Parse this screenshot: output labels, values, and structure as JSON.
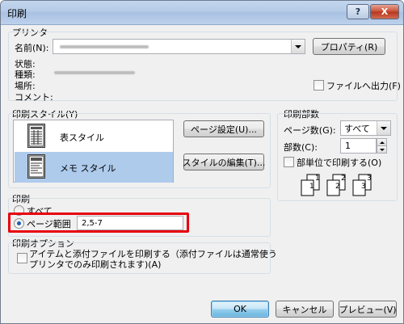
{
  "window": {
    "title": "印刷",
    "help_label": "?",
    "close_label": "X"
  },
  "printer": {
    "group_label": "プリンタ",
    "name_label": "名前(N):",
    "properties_button": "プロパティ(R)",
    "status_label": "状態:",
    "type_label": "種類:",
    "location_label": "場所:",
    "comment_label": "コメント:",
    "print_to_file_label": "ファイルへ出力(F)"
  },
  "print_style": {
    "group_label": "印刷スタイル(Y)",
    "items": [
      {
        "label": "表スタイル",
        "selected": false,
        "icon": "table-style-icon"
      },
      {
        "label": "メモ スタイル",
        "selected": true,
        "icon": "memo-style-icon"
      }
    ],
    "page_setup_button": "ページ設定(U)...",
    "edit_style_button": "スタイルの編集(T)..."
  },
  "copies": {
    "group_label": "印刷部数",
    "pages_label": "ページ数(G):",
    "pages_value": "すべて",
    "copies_label": "部数(C):",
    "copies_value": "1",
    "collate_label": "部単位で印刷する(O)",
    "collate_icon": "collate-pages-icon",
    "collate_page_numbers": [
      "1",
      "1",
      "2",
      "2",
      "3",
      "3"
    ]
  },
  "print_range": {
    "group_label": "印刷",
    "all_label": "すべて",
    "page_range_label": "ページ範囲",
    "page_range_value": "2,5-7",
    "selected": "page_range",
    "highlight_color": "#e8000b"
  },
  "print_options": {
    "group_label": "印刷オプション",
    "attachments_line1": "アイテムと添付ファイルを印刷する（添付ファイルは通常使う",
    "attachments_line2": "プリンタでのみ印刷されます)(A)"
  },
  "footer": {
    "ok_button": "OK",
    "cancel_button": "キャンセル",
    "preview_button": "プレビュー(V)"
  }
}
